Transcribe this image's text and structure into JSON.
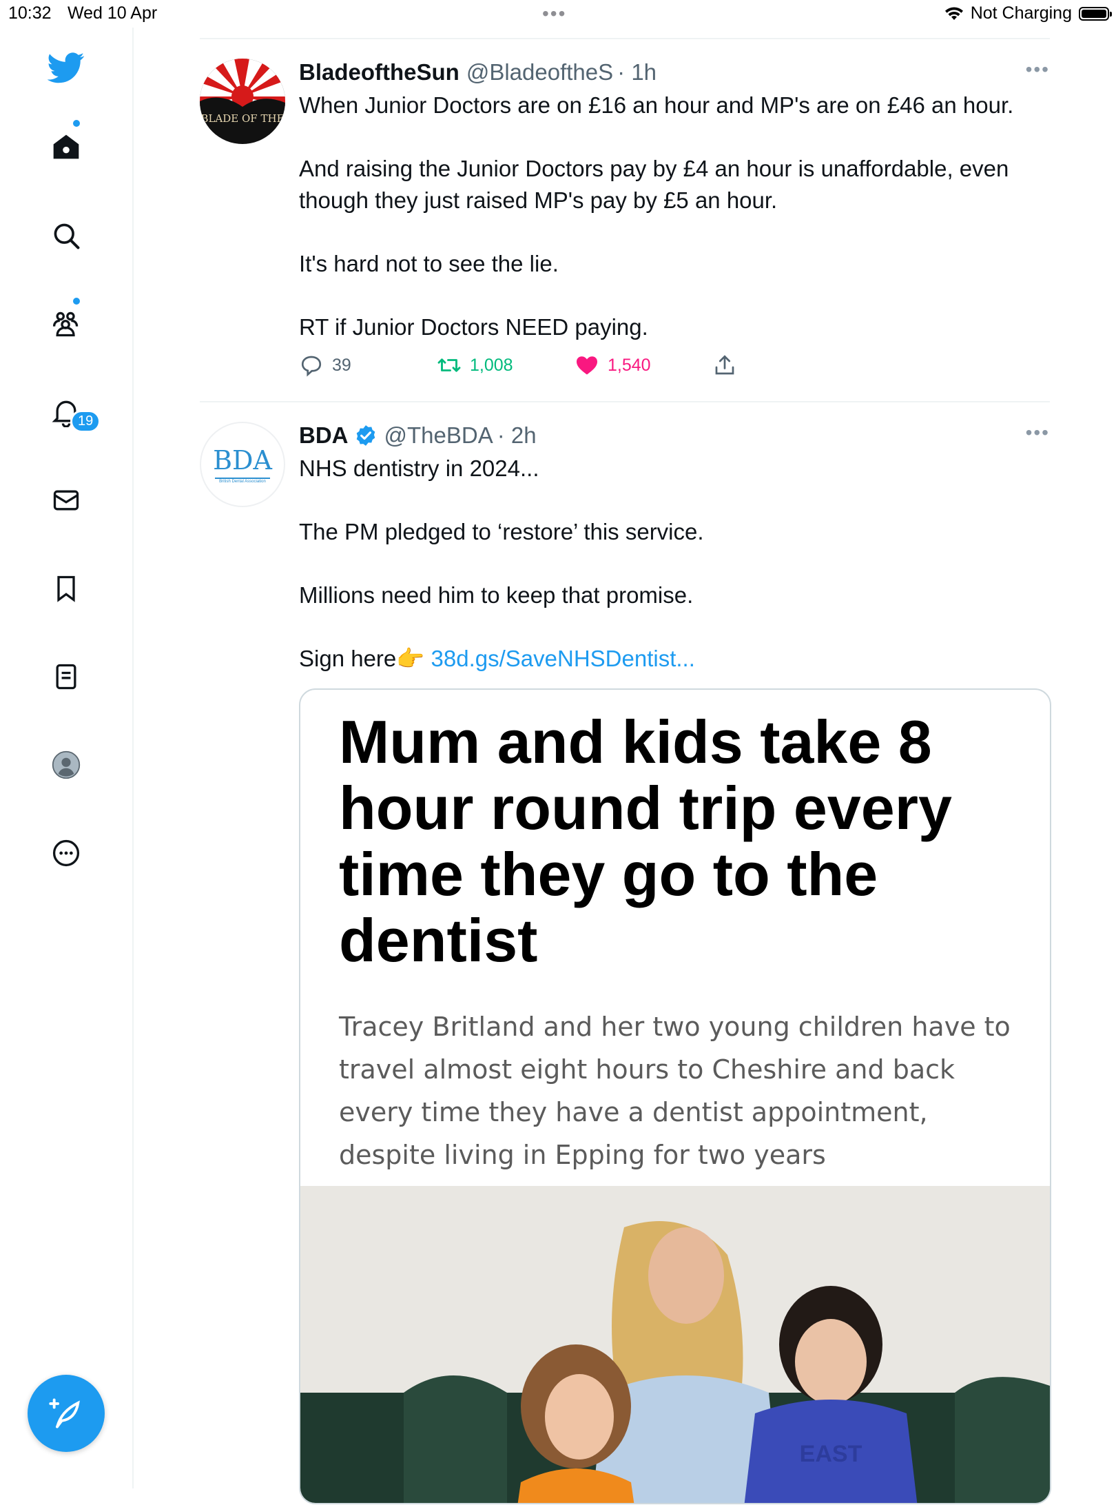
{
  "status_bar": {
    "time": "10:32",
    "date": "Wed 10 Apr",
    "charging": "Not Charging"
  },
  "sidebar": {
    "notifications_count": "19",
    "items": [
      "home-icon",
      "search-icon",
      "communities-icon",
      "notifications-icon",
      "messages-icon",
      "bookmarks-icon",
      "lists-icon",
      "profile-icon",
      "more-icon"
    ]
  },
  "colors": {
    "accent": "#1d9bf0",
    "like": "#f91880",
    "retweet": "#00ba7c"
  },
  "tweets": [
    {
      "name": "BladeoftheSun",
      "handle": "@BladeoftheS",
      "time": "· 1h",
      "paragraphs": [
        "When Junior Doctors are on £16 an hour and MP's are on £46 an hour.",
        "And raising the Junior Doctors pay by £4 an hour is unaffordable, even though they just raised MP's pay by £5 an hour.",
        "It's hard not to see the lie.",
        "RT if Junior Doctors NEED paying."
      ],
      "replies": "39",
      "retweets": "1,008",
      "likes": "1,540",
      "avatar_text": "BLADE OF THE"
    },
    {
      "name": "BDA",
      "handle": "@TheBDA",
      "time": "· 2h",
      "avatar_text": "BDA",
      "avatar_subtext": "British Dental Association",
      "paragraphs": [
        "NHS dentistry in 2024...",
        "The PM pledged to ‘restore’ this service.",
        "Millions need him to keep that promise."
      ],
      "sign_text": "Sign here",
      "sign_emoji": "👉",
      "link_text": "38d.gs/SaveNHSDentist...",
      "card": {
        "headline": "Mum and kids take 8 hour round trip every time they go to the dentist",
        "summary": "Tracey Britland and her two young children have to travel almost eight hours to Cheshire and back every time they have a dentist appointment, despite living in Epping for two years",
        "photo_shirt_text": "EAST"
      }
    }
  ]
}
